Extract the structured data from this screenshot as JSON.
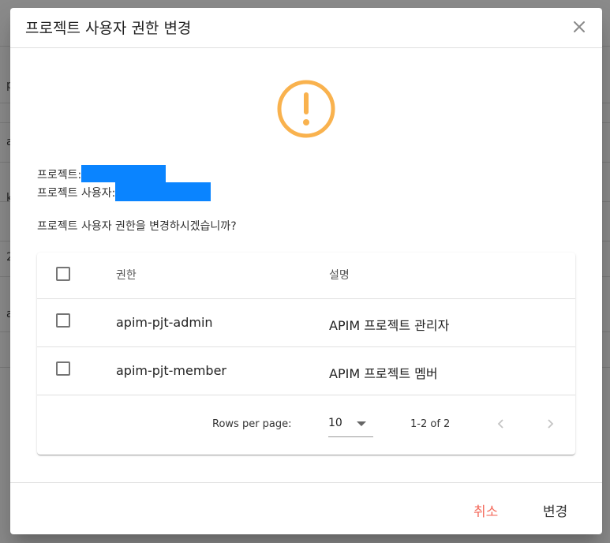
{
  "dialog": {
    "title": "프로젝트 사용자 권한 변경",
    "project_label": "프로젝트:",
    "project_user_label": "프로젝트 사용자:",
    "question": "프로젝트 사용자 권한을 변경하시겠습니까?",
    "warning_icon": "exclamation-circle-icon",
    "warning_color": "#f9b24e",
    "mask_color": "#0a84ff"
  },
  "table": {
    "columns": [
      "권한",
      "설명"
    ],
    "rows": [
      {
        "role": "apim-pjt-admin",
        "desc": "APIM 프로젝트 관리자",
        "checked": false
      },
      {
        "role": "apim-pjt-member",
        "desc": "APIM 프로젝트 멤버",
        "checked": false
      }
    ],
    "rows_per_page_label": "Rows per page:",
    "rows_per_page_value": "10",
    "range": "1-2 of 2"
  },
  "actions": {
    "cancel": "취소",
    "confirm": "변경",
    "cancel_color": "#f46b5d"
  },
  "backdrop": {
    "row_letters": [
      "p",
      "a",
      "k",
      "2",
      "a"
    ]
  }
}
